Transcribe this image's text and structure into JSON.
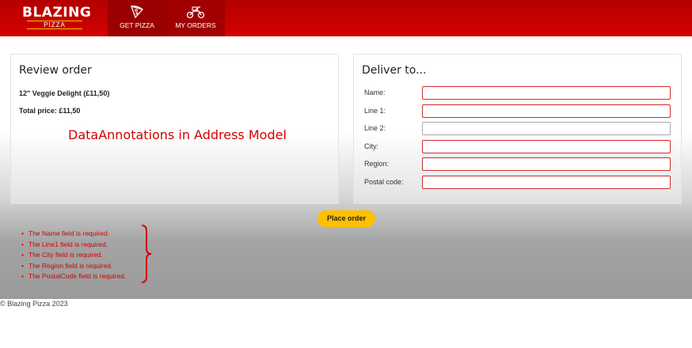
{
  "header": {
    "logo_main": "BLAZING",
    "logo_sub": "PIZZA",
    "nav": [
      {
        "label": "GET PIZZA",
        "icon": "pizza-slice-icon"
      },
      {
        "label": "MY ORDERS",
        "icon": "scooter-icon"
      }
    ]
  },
  "review": {
    "title": "Review order",
    "item": "12\" Veggie Delight (£11,50)",
    "total": "Total price: £11,50"
  },
  "annotation": "DataAnnotations in Address Model",
  "deliver": {
    "title": "Deliver to...",
    "fields": [
      {
        "label": "Name:",
        "value": "",
        "invalid": true
      },
      {
        "label": "Line 1:",
        "value": "",
        "invalid": true
      },
      {
        "label": "Line 2:",
        "value": "",
        "invalid": false
      },
      {
        "label": "City:",
        "value": "",
        "invalid": true
      },
      {
        "label": "Region:",
        "value": "",
        "invalid": true
      },
      {
        "label": "Postal code:",
        "value": "",
        "invalid": true
      }
    ]
  },
  "place_order_label": "Place order",
  "errors": [
    "The Name field is required.",
    "The Line1 field is required.",
    "The City field is required.",
    "The Region field is required.",
    "The PostalCode field is required."
  ],
  "footer": "© Blazing Pizza 2023",
  "colors": {
    "brand_red": "#d40000",
    "accent_yellow": "#ffc000",
    "error_red": "#d22a2a"
  }
}
